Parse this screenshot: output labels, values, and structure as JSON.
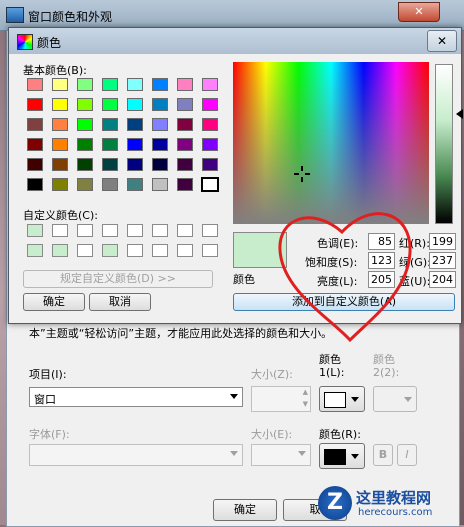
{
  "back_window": {
    "title": "窗口颜色和外观",
    "hint": "本”主题或“轻松访问”主题，才能应用此处选择的颜色和大小。",
    "item_label": "项目(I):",
    "item_value": "窗口",
    "size_label": "大小(Z):",
    "color1_label": "颜色",
    "color1_sub": "1(L):",
    "color2_label": "颜色",
    "color2_sub": "2(2):",
    "font_label": "字体(F):",
    "font_size_label": "大小(E):",
    "font_color_label": "颜色(R):",
    "bold_label": "B",
    "italic_label": "I",
    "ok_label": "确定",
    "cancel_label": "取"
  },
  "dialog": {
    "title": "颜色",
    "basic_colors_label": "基本颜色(B):",
    "custom_colors_label": "自定义颜色(C):",
    "define_custom_label": "规定自定义颜色(D) >>",
    "ok_label": "确定",
    "cancel_label": "取消",
    "color_solid_label": "颜色",
    "add_to_custom_label": "添加到自定义颜色(A)",
    "hue_label": "色调(E):",
    "hue": "85",
    "sat_label": "饱和度(S):",
    "sat": "123",
    "lum_label": "亮度(L):",
    "lum": "205",
    "red_label": "红(R):",
    "red": "199",
    "green_label": "绿(G):",
    "green": "237",
    "blue_label": "蓝(U):",
    "blue": "204"
  },
  "basic_colors": [
    [
      "#ff8080",
      "#ffff80",
      "#80ff80",
      "#00ff80",
      "#80ffff",
      "#0080ff",
      "#ff80c0",
      "#ff80ff"
    ],
    [
      "#ff0000",
      "#ffff00",
      "#80ff00",
      "#00ff40",
      "#00ffff",
      "#0080c0",
      "#8080c0",
      "#ff00ff"
    ],
    [
      "#804040",
      "#ff8040",
      "#00ff00",
      "#008080",
      "#004080",
      "#8080ff",
      "#800040",
      "#ff0080"
    ],
    [
      "#800000",
      "#ff8000",
      "#008000",
      "#008040",
      "#0000ff",
      "#0000a0",
      "#800080",
      "#8000ff"
    ],
    [
      "#400000",
      "#804000",
      "#004000",
      "#004040",
      "#000080",
      "#000040",
      "#400040",
      "#400080"
    ],
    [
      "#000000",
      "#808000",
      "#808040",
      "#808080",
      "#408080",
      "#c0c0c0",
      "#400040",
      "#ffffff"
    ]
  ],
  "custom_colors": [
    [
      "#c7edcc",
      "#ffffff",
      "#ffffff",
      "#ffffff",
      "#ffffff",
      "#ffffff",
      "#ffffff",
      "#ffffff"
    ],
    [
      "#c7edcc",
      "#c7edcc",
      "#ffffff",
      "#c7edcc",
      "#ffffff",
      "#ffffff",
      "#ffffff",
      "#ffffff"
    ]
  ],
  "watermark": {
    "title": "这里教程网",
    "url": "herecours.com"
  }
}
